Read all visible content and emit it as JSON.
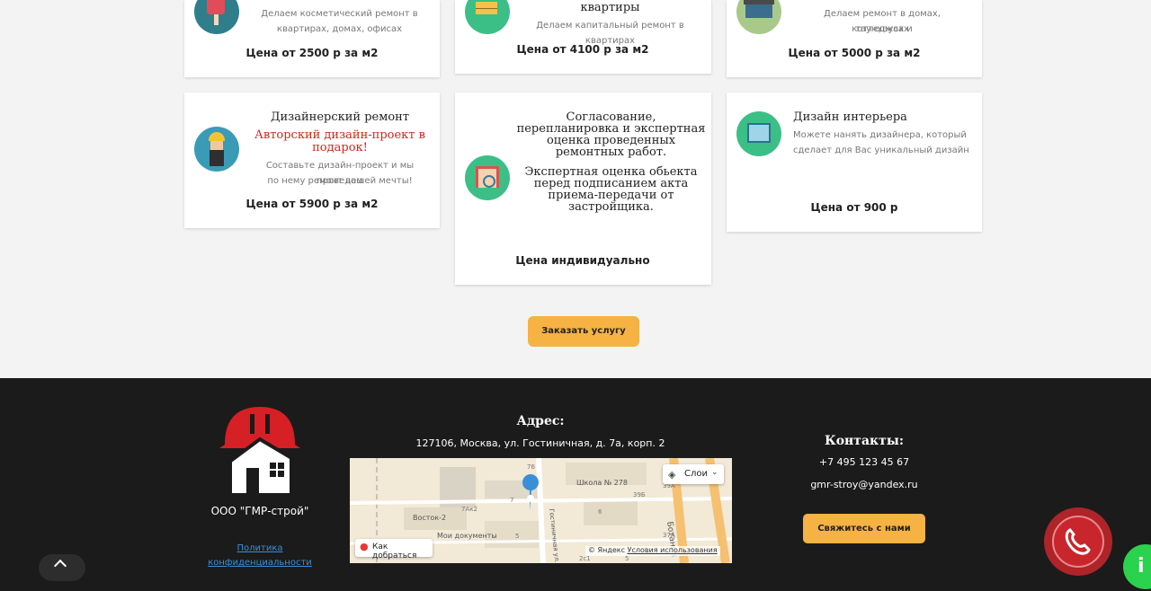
{
  "cards": {
    "c1": {
      "desc1": "Делаем косметический ремонт в",
      "desc2": "квартирах, домах, офисах",
      "price": "Цена от 2500 р за м2"
    },
    "c2": {
      "title": "квартиры",
      "desc": "Делаем капитальный ремонт в квартирах",
      "price": "Цена от 4100 р за м2"
    },
    "c3": {
      "desc1": "Делаем  ремонт в домах, коттеджах и",
      "desc2": "таунхаусах",
      "price": "Цена от 5000 р за м2"
    },
    "c4": {
      "title": "Дизайнерский ремонт",
      "red1": "Авторский дизайн-проект в",
      "red2": "подарок!",
      "desc1": "Составьте дизайн-проект и мы проведем",
      "desc2": "по нему ремонт вашей мечты!",
      "price": "Цена от 5900 р за м2"
    },
    "c5": {
      "title1": "Согласование,",
      "title2": "перепланировка и экспертная",
      "title3": "оценка проведенных",
      "title4": "ремонтных работ.",
      "sub1": "Экспертная оценка обьекта",
      "sub2": "перед подписанием акта",
      "sub3": "приема-передачи от",
      "sub4": "застройщика.",
      "price": "Цена индивидуально"
    },
    "c6": {
      "title": "Дизайн интерьера",
      "desc1": "Можете нанять дизайнера, который",
      "desc2": "сделает для Вас уникальный дизайн",
      "price": "Цена от 900 р"
    }
  },
  "order_button": "Заказать услугу",
  "footer": {
    "company": "ООО \"ГМР-строй\"",
    "policy1": "Политика",
    "policy2": "конфиденциальности",
    "address_title": "Адрес:",
    "address": "127106, Москва, ул. Гостиничная, д. 7а, корп. 2",
    "contacts_title": "Контакты:",
    "phone": "+7 495 123 45 67",
    "email": "gmr-stroy@yandex.ru",
    "contact_button": "Свяжитесь с нами"
  },
  "map": {
    "layers": "Слои",
    "route": "Как добраться",
    "copyright": "© Яндекс",
    "terms": "Условия использования",
    "labels": [
      "Школа № 278",
      "Восток-2",
      "Мои документы",
      "Ботанич",
      "Гостиничная ул."
    ],
    "numbers": [
      "76",
      "7",
      "7Ак2",
      "6",
      "5",
      "39Б",
      "39А",
      "37А",
      "2с1",
      "5"
    ]
  },
  "colors": {
    "accent": "#f6b243",
    "footer_bg": "#1b1b1b",
    "red_text": "#d0261d",
    "call_red": "#c8262c",
    "whatsapp_green": "#2bd24e"
  }
}
